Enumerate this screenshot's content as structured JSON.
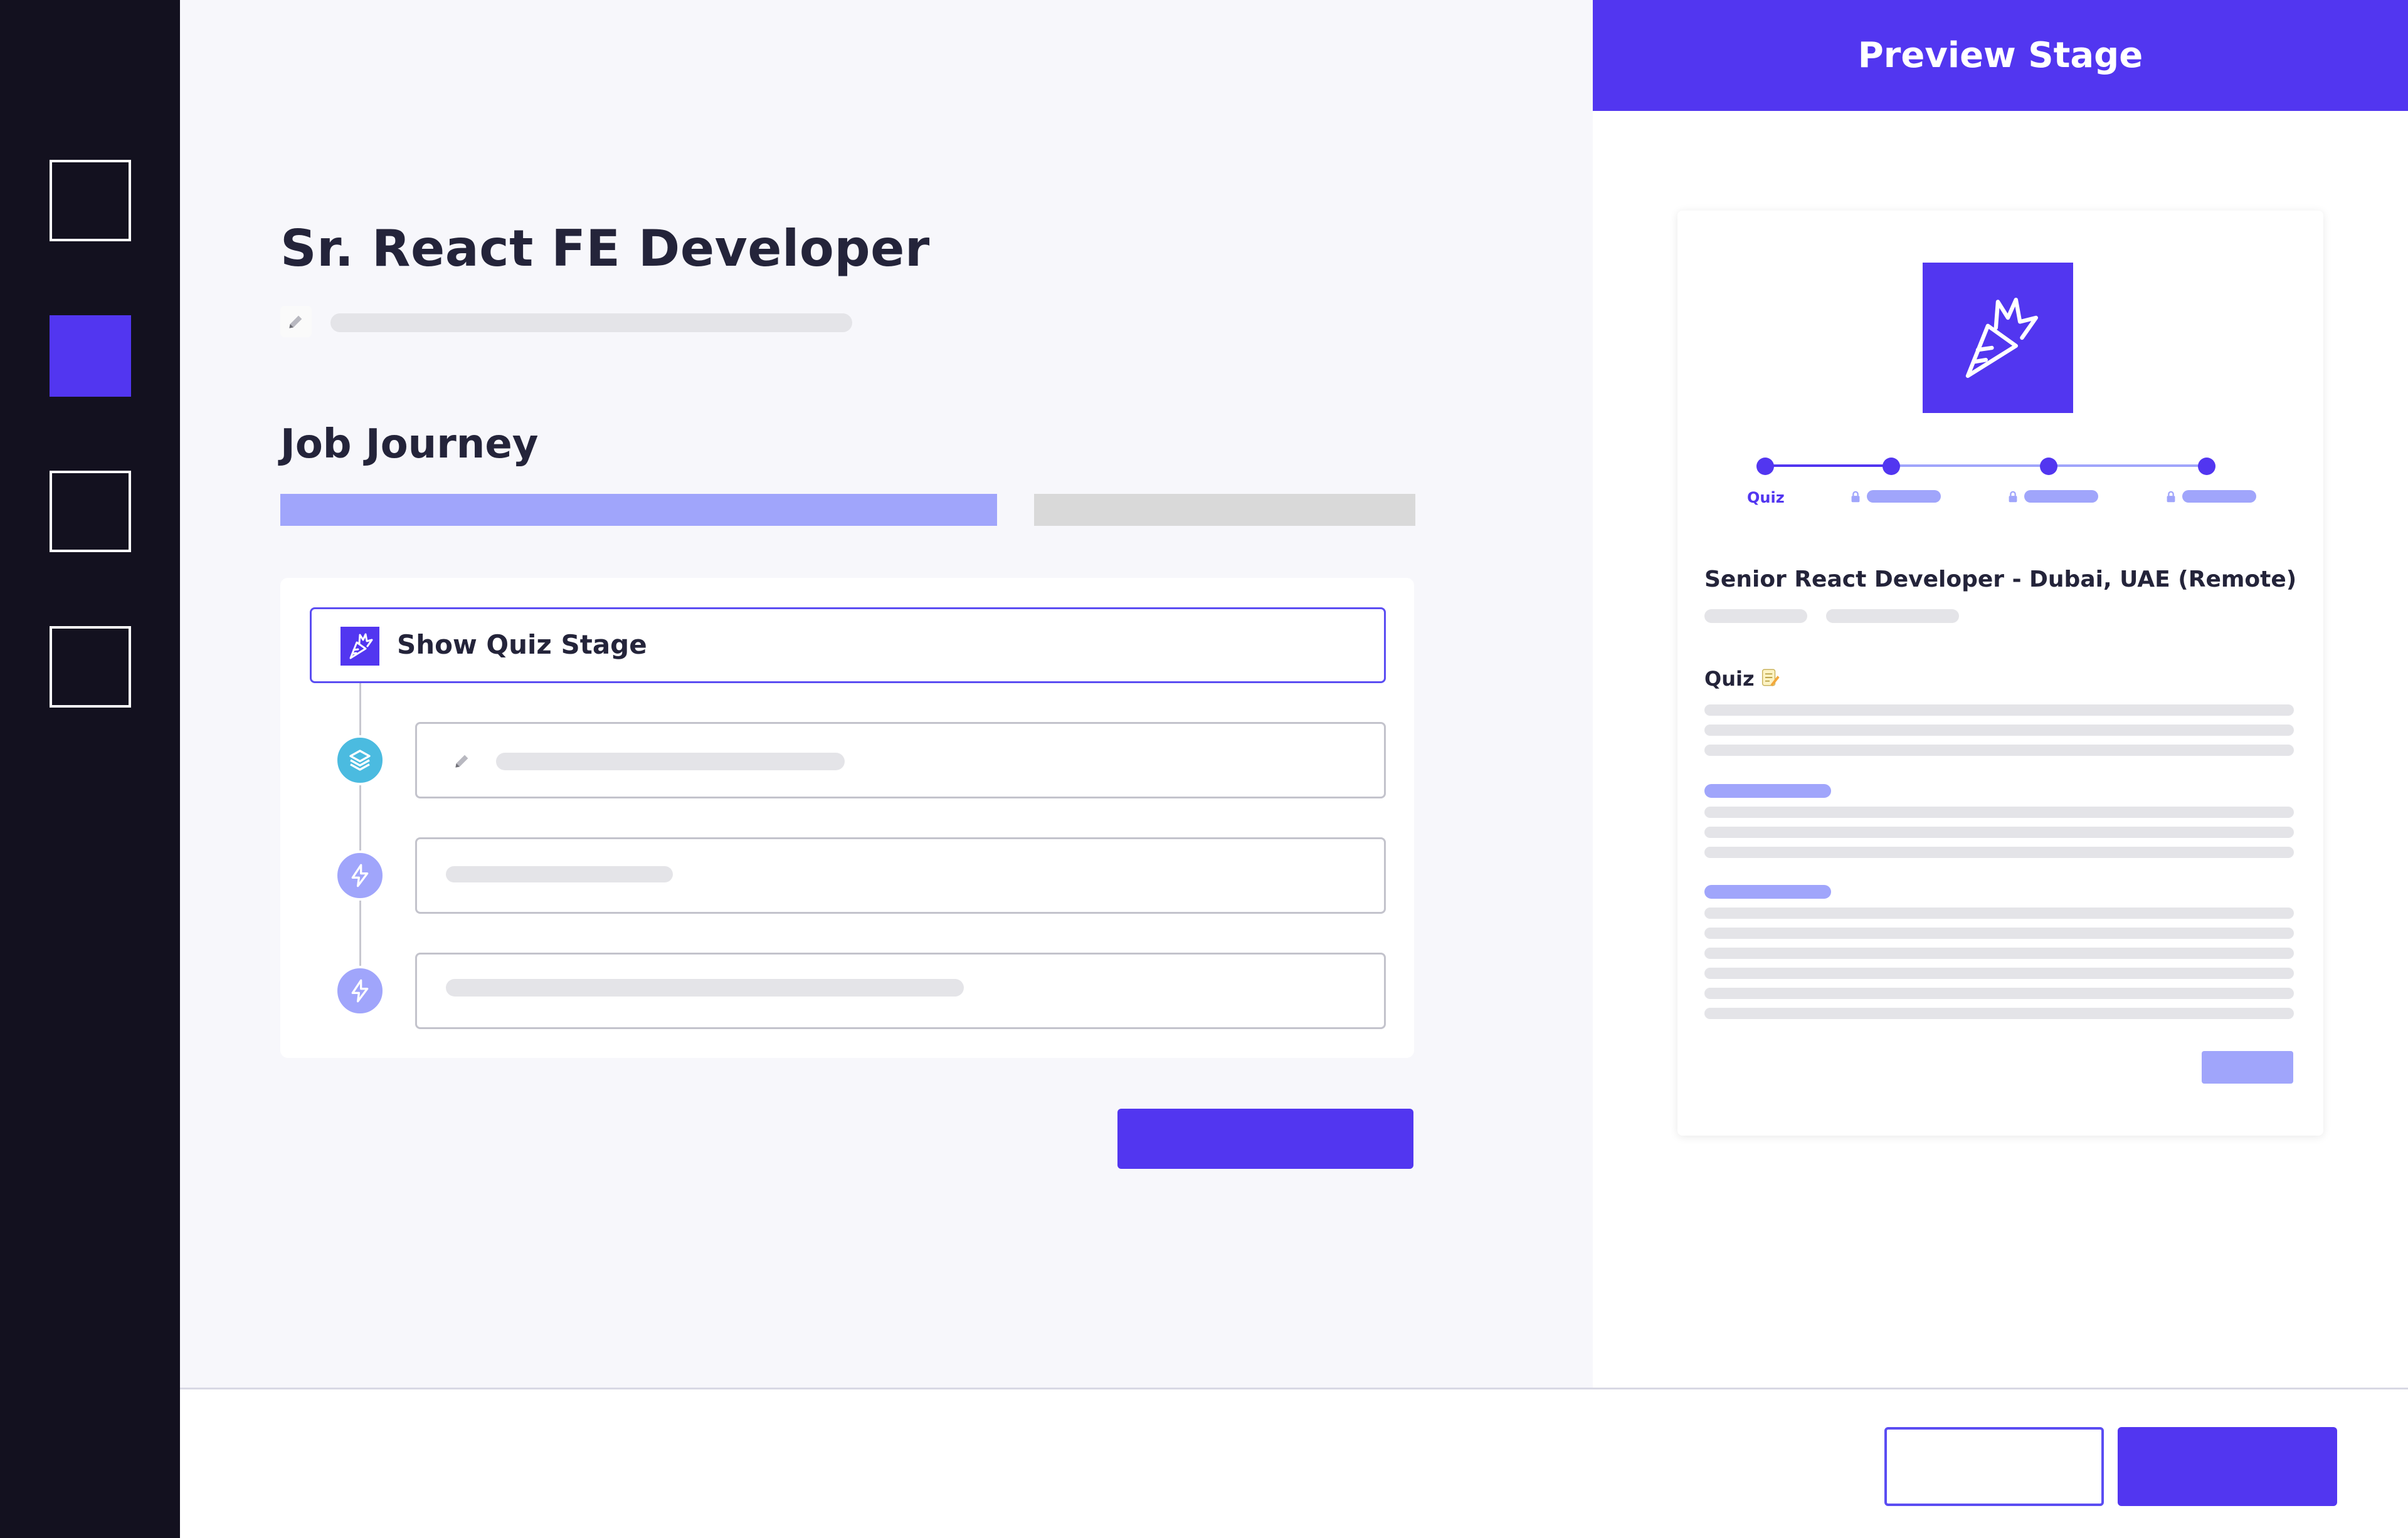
{
  "sidebar": {
    "items": [
      {
        "name": "nav-item-1",
        "active": false
      },
      {
        "name": "nav-item-2",
        "active": true
      },
      {
        "name": "nav-item-3",
        "active": false
      },
      {
        "name": "nav-item-4",
        "active": false
      }
    ]
  },
  "main": {
    "job_title": "Sr. React FE Developer",
    "section_title": "Job Journey",
    "stage": {
      "label": "Show Quiz Stage",
      "icon": "carrot-icon"
    },
    "steps": [
      {
        "icon": "layers-icon",
        "color": "#4bbbe0"
      },
      {
        "icon": "lightning-icon",
        "color": "#a0a5fb"
      },
      {
        "icon": "lightning-icon",
        "color": "#a0a5fb"
      }
    ]
  },
  "preview": {
    "header_title": "Preview Stage",
    "progress": {
      "first_label": "Quiz"
    },
    "job_heading": "Senior React Developer - Dubai, UAE (Remote)",
    "quiz_label": "Quiz",
    "quiz_emoji": "memo-icon"
  },
  "colors": {
    "accent": "#5236f0",
    "accent_light": "#a0a5fb",
    "sidebar_bg": "#13111f",
    "skeleton": "#e4e4e8"
  }
}
